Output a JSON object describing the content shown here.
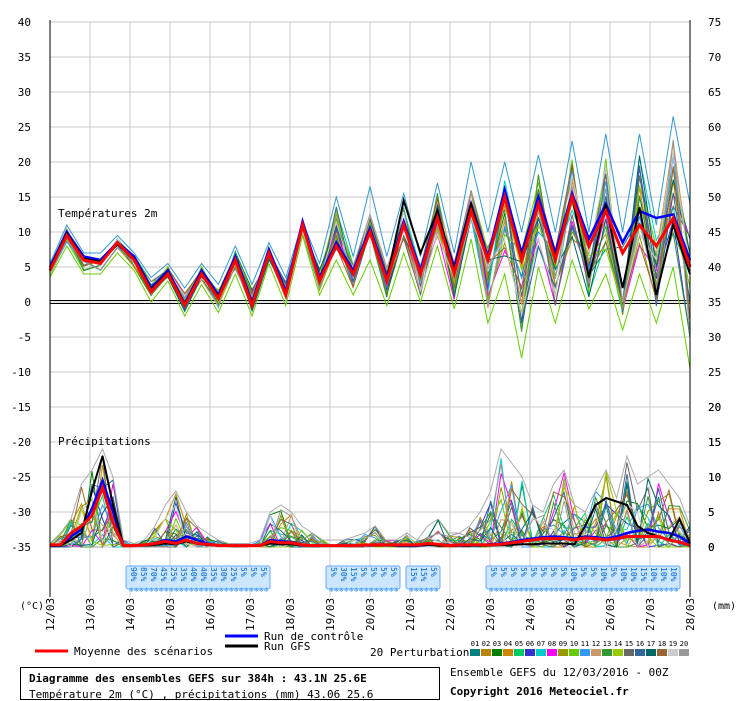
{
  "chart_data": {
    "type": "line",
    "labels": {
      "temperature": "Températures 2m",
      "precipitation": "Précipitations",
      "left_axis_unit": "(°C)",
      "right_axis_unit": "(mm)"
    },
    "temperature_axis": {
      "min": -35,
      "max": 40,
      "ticks": [
        40,
        35,
        30,
        25,
        20,
        15,
        10,
        5,
        0,
        -5,
        -10,
        -15,
        -20,
        -25,
        -30,
        -35
      ]
    },
    "right_axis": {
      "temperature_ticks": [
        75,
        70,
        65,
        60,
        55,
        50,
        45,
        40,
        35,
        30,
        25,
        20,
        15,
        10,
        5,
        0
      ],
      "precipitation_ticks": [
        20,
        15,
        10,
        5,
        0
      ]
    },
    "dates": [
      "12/03",
      "13/03",
      "14/03",
      "15/03",
      "16/03",
      "17/03",
      "18/03",
      "19/03",
      "20/03",
      "21/03",
      "22/03",
      "23/03",
      "24/03",
      "25/03",
      "26/03",
      "27/03",
      "28/03"
    ],
    "temperature_series": [
      {
        "name": "Moyenne des scénarios",
        "color": "#ff0000",
        "values": [
          4.5,
          9.5,
          6,
          5.5,
          8.5,
          6,
          1.5,
          4,
          -0.5,
          4,
          0.5,
          6,
          -0.5,
          7,
          1,
          11,
          3,
          8,
          4,
          10,
          3,
          11,
          4,
          12,
          4,
          13,
          6,
          15,
          6,
          14,
          6,
          15,
          8,
          13,
          7,
          11,
          8,
          12,
          5
        ]
      },
      {
        "name": "Run de contrôle",
        "color": "#0000ff",
        "values": [
          5,
          10,
          6.5,
          6,
          8.5,
          6.5,
          2,
          4.5,
          -0.3,
          4.5,
          1,
          6.5,
          0,
          7.5,
          1.5,
          11.5,
          3.5,
          8.5,
          4.5,
          10.5,
          3.5,
          11.5,
          4.5,
          12.5,
          5,
          14,
          6.5,
          16,
          7,
          15,
          7,
          15.5,
          9,
          14,
          8.5,
          13,
          12,
          12.5,
          6
        ]
      },
      {
        "name": "Run GFS",
        "color": "#000000",
        "values": [
          4.8,
          9.8,
          6.2,
          5.8,
          8.2,
          6.2,
          1.8,
          4.2,
          -0.2,
          4.2,
          0.8,
          6.2,
          -0.2,
          7.2,
          1.2,
          11.2,
          3.2,
          8.2,
          4.2,
          10.2,
          3.2,
          14.5,
          7,
          13,
          4.5,
          14,
          6,
          15,
          6.5,
          14,
          6.5,
          15,
          3.5,
          14,
          2,
          13.5,
          1,
          11,
          4
        ]
      }
    ],
    "temperature_envelope": {
      "upper": [
        5.5,
        11,
        7,
        7,
        9.5,
        7,
        3.5,
        5.5,
        2,
        5.5,
        2.5,
        8,
        2.5,
        8.5,
        3.5,
        11.5,
        5.5,
        15,
        6.5,
        16.5,
        6.5,
        15.5,
        6.5,
        17,
        7,
        20,
        10,
        20,
        10,
        21,
        10,
        23,
        10,
        24,
        10,
        24,
        11,
        26.5,
        14
      ],
      "lower": [
        3.5,
        8,
        4,
        4,
        7,
        4.5,
        0,
        3,
        -2,
        2.5,
        -1.5,
        4,
        -2,
        5.5,
        -0.5,
        9.5,
        1,
        6,
        1,
        6,
        -0.5,
        7,
        0,
        8,
        -1,
        9,
        -3,
        4,
        -8,
        5,
        -3,
        6,
        -1,
        4,
        -4,
        4,
        -3,
        5,
        -9.5
      ]
    },
    "precipitation_series": [
      {
        "name": "Moyenne des scénarios",
        "color": "#ff0000",
        "values": [
          0.3,
          0.3,
          2,
          3,
          4.5,
          8.5,
          3.5,
          0.2,
          0.2,
          0.3,
          0.5,
          0.8,
          0.5,
          1,
          0.5,
          0.4,
          0.2,
          0.2,
          0.2,
          0.2,
          0.2,
          0.8,
          0.6,
          0.6,
          0.3,
          0.2,
          0.2,
          0.2,
          0.2,
          0.2,
          0.3,
          0.3,
          0.3,
          0.3,
          0.3,
          0.3,
          0.5,
          0.4,
          0.2,
          0.3,
          0.3,
          0.3,
          0.3,
          0.4,
          0.6,
          0.8,
          1,
          1.2,
          1.2,
          1.2,
          1,
          1.3,
          1.2,
          1,
          1.2,
          1.5,
          1.5,
          1.5,
          1.5,
          1,
          0.7,
          0.2
        ]
      },
      {
        "name": "Run de contrôle",
        "color": "#0000ff",
        "values": [
          0.2,
          0.2,
          1.5,
          2.5,
          5.5,
          9.5,
          5,
          0.2,
          0.2,
          0.3,
          0.5,
          1,
          0.8,
          1.5,
          1,
          0.5,
          0.2,
          0.2,
          0.2,
          0.2,
          0.2,
          1,
          0.8,
          0.7,
          0.3,
          0.2,
          0.2,
          0.2,
          0.2,
          0.2,
          0.3,
          0.3,
          0.3,
          0.2,
          0.2,
          0.2,
          0.3,
          0.3,
          0.2,
          0.2,
          0.2,
          0.3,
          0.4,
          0.5,
          0.7,
          1,
          1.2,
          1.4,
          1.5,
          1.4,
          1.2,
          1.5,
          1.4,
          1.2,
          1.5,
          2,
          2.3,
          2.5,
          2.2,
          2,
          1.5,
          0.5
        ]
      },
      {
        "name": "Run GFS",
        "color": "#000000",
        "values": [
          0.2,
          0.2,
          1,
          2,
          8,
          13,
          6,
          0.2,
          0.2,
          0.2,
          0.3,
          0.5,
          0.4,
          0.8,
          0.5,
          0.3,
          0.2,
          0.2,
          0.2,
          0.2,
          0.2,
          0.5,
          0.4,
          0.4,
          0.2,
          0.2,
          0.2,
          0.2,
          0.2,
          0.2,
          0.2,
          0.2,
          0.2,
          0.2,
          0.2,
          0.2,
          0.3,
          0.2,
          0.2,
          0.2,
          0.2,
          0.2,
          0.2,
          0.3,
          0.3,
          0.4,
          0.4,
          0.5,
          0.5,
          0.5,
          0.4,
          3,
          6,
          7,
          6.5,
          6,
          3,
          2,
          1.5,
          1,
          4,
          0.5
        ]
      }
    ],
    "precipitation_envelope": {
      "upper": [
        0.5,
        2,
        4,
        9,
        11,
        14,
        10,
        1,
        0.5,
        1,
        3,
        6,
        8,
        5,
        3,
        2,
        1,
        0.5,
        0.5,
        0.5,
        1,
        5,
        6,
        5,
        3,
        2,
        1,
        1,
        1,
        1.5,
        2,
        3,
        1,
        1,
        2,
        1,
        3,
        4,
        2,
        2,
        3,
        5,
        8,
        14,
        12,
        10,
        6,
        5,
        9,
        11,
        6,
        5,
        8,
        11,
        7,
        13,
        9,
        10,
        11,
        9,
        7,
        3
      ],
      "lower": [
        0,
        0,
        0,
        0,
        0.2,
        1,
        0.5,
        0,
        0,
        0,
        0,
        0,
        0,
        0,
        0,
        0,
        0,
        0,
        0,
        0,
        0,
        0,
        0,
        0,
        0,
        0,
        0,
        0,
        0,
        0,
        0,
        0,
        0,
        0,
        0,
        0,
        0,
        0,
        0,
        0,
        0,
        0,
        0,
        0,
        0,
        0,
        0,
        0,
        0,
        0,
        0,
        0,
        0,
        0,
        0,
        0,
        0,
        0,
        0,
        0,
        0,
        0
      ]
    },
    "snow_probabilities": [
      {
        "date_index": 2,
        "values": [
          "90%",
          "85%",
          "70%",
          "45%",
          "25%",
          "35%",
          "40%",
          "40%",
          "35%",
          "30%",
          "25%",
          "5%",
          "5%",
          "5%"
        ]
      },
      {
        "date_index": 7,
        "values": [
          "5%",
          "30%",
          "15%",
          "5%",
          "5%",
          "5%",
          "5%"
        ]
      },
      {
        "date_index": 9,
        "values": [
          "15%",
          "15%",
          "5%"
        ]
      },
      {
        "date_index": 11,
        "values": [
          "5%",
          "5%",
          "5%",
          "5%",
          "5%",
          "5%",
          "5%",
          "5%",
          "10%",
          "5%",
          "5%",
          "10%",
          "5%",
          "10%",
          "10%",
          "15%",
          "10%",
          "10%",
          "10%"
        ]
      }
    ],
    "legend": {
      "mean": "Moyenne des scénarios",
      "control": "Run de contrôle",
      "gfs": "Run GFS",
      "perturbations": "20 Perturbations",
      "perturbation_ids": [
        "01",
        "02",
        "03",
        "04",
        "05",
        "06",
        "07",
        "08",
        "09",
        "10",
        "11",
        "12",
        "13",
        "14",
        "15",
        "16",
        "17",
        "18",
        "19",
        "20"
      ],
      "perturbation_colors": [
        "#008080",
        "#b8860b",
        "#008000",
        "#cc8800",
        "#00cc66",
        "#3333cc",
        "#00cccc",
        "#ff00ff",
        "#999900",
        "#66cc00",
        "#3399ff",
        "#cc9966",
        "#339933",
        "#99cc00",
        "#666666",
        "#336699",
        "#006666",
        "#996633",
        "#cccccc",
        "#999999"
      ]
    },
    "grid": true
  },
  "footer": {
    "title": "Diagramme des ensembles GEFS sur 384h : 43.1N 25.6E",
    "subtitle": "Température 2m (°C) , précipitations (mm) 43.06 25.6",
    "ensemble": "Ensemble GEFS du 12/03/2016 - 00Z",
    "copyright": "Copyright 2016 Meteociel.fr"
  }
}
